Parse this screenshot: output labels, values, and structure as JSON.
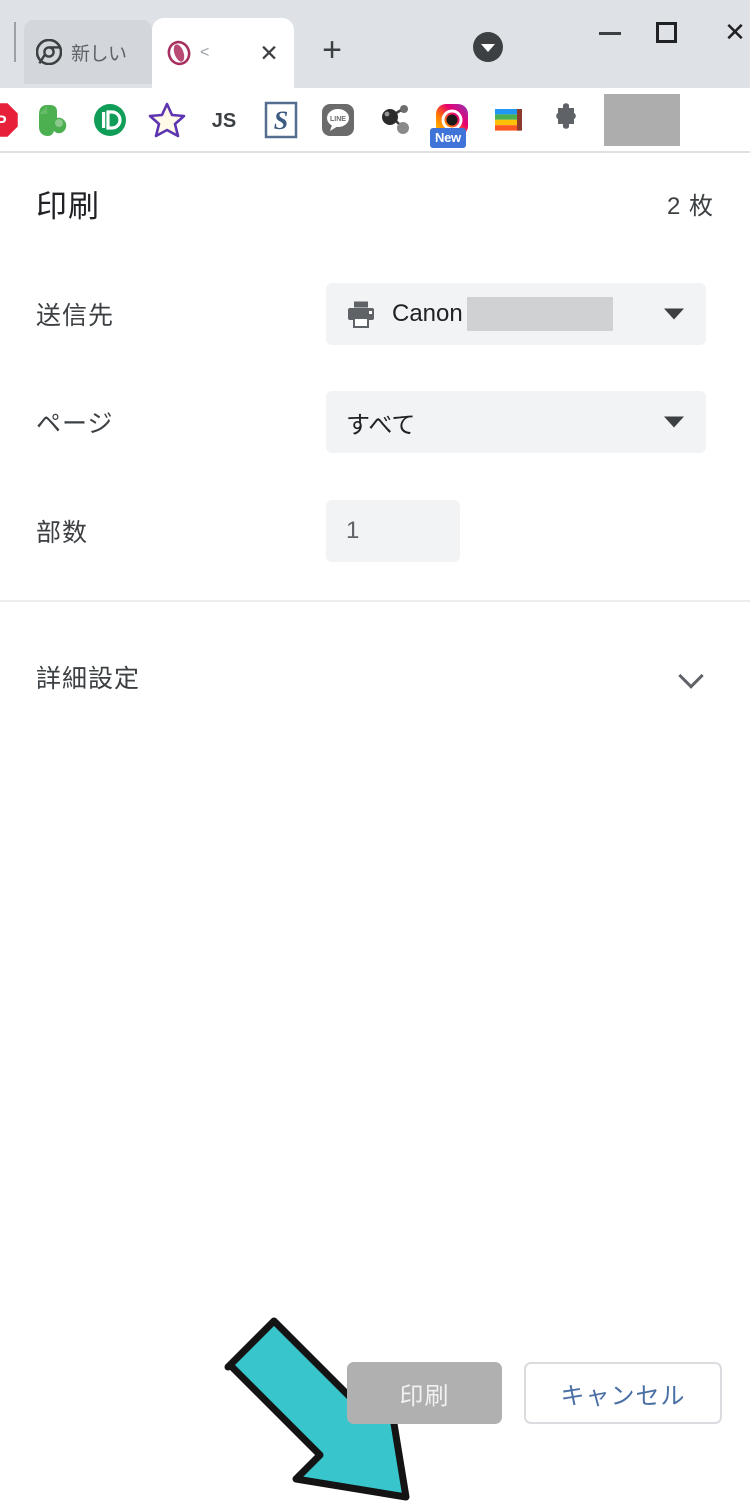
{
  "browser": {
    "tabs": [
      {
        "title": "新しい",
        "favicon": "chrome-icon",
        "active": false
      },
      {
        "title": "<",
        "favicon": "site-icon",
        "active": true
      }
    ],
    "new_tab_label": "+",
    "tab_search_label": "tab-search-icon",
    "window_controls": {
      "minimize": "minimize-icon",
      "maximize": "maximize-icon",
      "close": "✕"
    },
    "bookmarks": [
      {
        "name": "stop-p-icon",
        "label": "P"
      },
      {
        "name": "evernote-icon",
        "label": ""
      },
      {
        "name": "id-circle-icon",
        "label": "ID"
      },
      {
        "name": "star-icon",
        "label": ""
      },
      {
        "name": "js-icon",
        "label": "JS"
      },
      {
        "name": "s-square-icon",
        "label": "S"
      },
      {
        "name": "line-icon",
        "label": "LINE"
      },
      {
        "name": "molecule-icon",
        "label": ""
      },
      {
        "name": "instagram-icon",
        "label": "",
        "badge": "New"
      },
      {
        "name": "rainbow-books-icon",
        "label": ""
      },
      {
        "name": "extensions-puzzle-icon",
        "label": ""
      }
    ]
  },
  "print_dialog": {
    "title": "印刷",
    "sheets": "2 枚",
    "rows": {
      "destination": {
        "label": "送信先",
        "value": "Canon",
        "icon": "printer-icon",
        "redacted": true
      },
      "pages": {
        "label": "ページ",
        "value": "すべて"
      },
      "copies": {
        "label": "部数",
        "value": "1"
      }
    },
    "advanced": {
      "label": "詳細設定",
      "expanded": false
    },
    "footer": {
      "print_label": "印刷",
      "print_disabled": true,
      "cancel_label": "キャンセル"
    }
  },
  "annotation": {
    "arrow": {
      "name": "pointer-arrow",
      "direction": "down-right",
      "fill_color": "#38c6cc",
      "stroke_color": "#1a1a1a",
      "points_at": "印刷"
    }
  },
  "colors": {
    "chrome_bar": "#dee1e6",
    "dialog_bg": "#ffffff",
    "field_bg": "#f1f3f4",
    "cancel_text": "#4a6fa5",
    "print_disabled_bg": "#b0b0b0",
    "arrow": "#38c6cc"
  }
}
